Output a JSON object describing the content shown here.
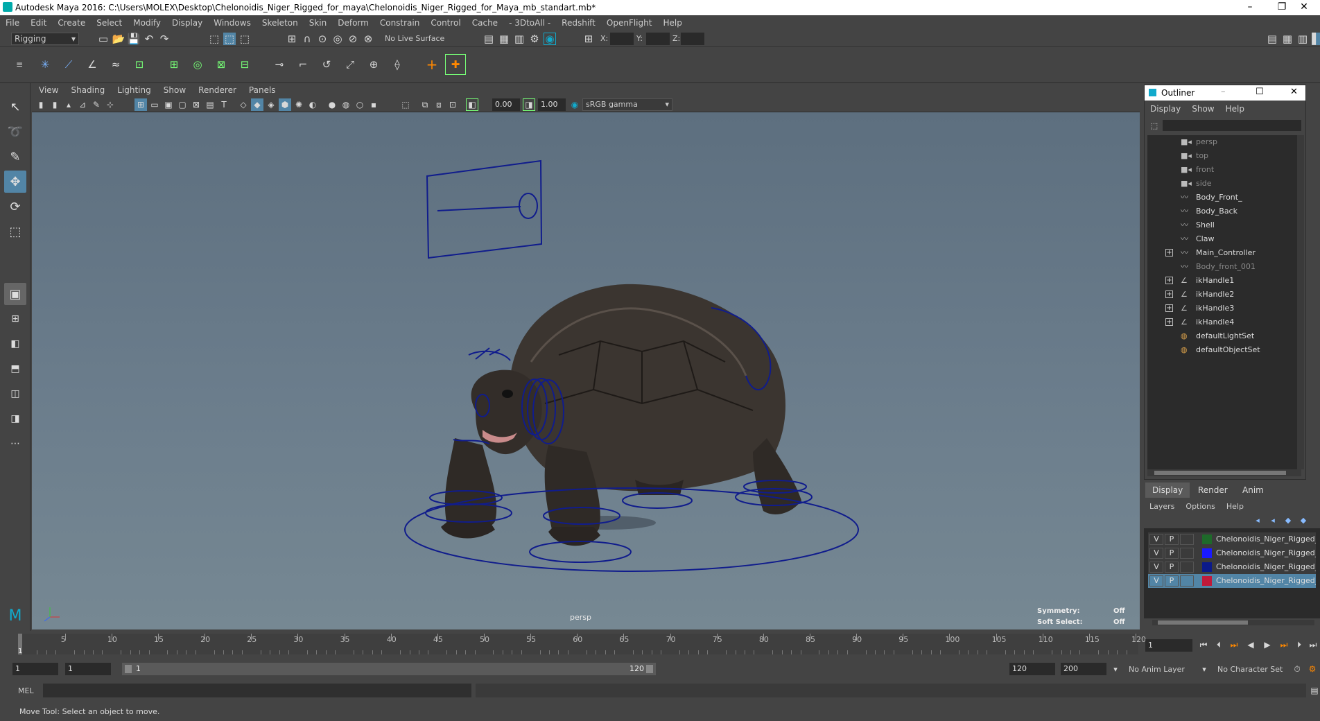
{
  "window": {
    "title": "Autodesk Maya 2016: C:\\Users\\MOLEX\\Desktop\\Chelonoidis_Niger_Rigged_for_maya\\Chelonoidis_Niger_Rigged_for_Maya_mb_standart.mb*"
  },
  "menu": [
    "File",
    "Edit",
    "Create",
    "Select",
    "Modify",
    "Display",
    "Windows",
    "Skeleton",
    "Skin",
    "Deform",
    "Constrain",
    "Control",
    "Cache",
    "- 3DtoAll -",
    "Redshift",
    "OpenFlight",
    "Help"
  ],
  "statusline": {
    "mode": "Rigging",
    "live_surface": "No Live Surface",
    "x_label": "X:",
    "y_label": "Y:",
    "z_label": "Z:"
  },
  "viewport": {
    "menu": [
      "View",
      "Shading",
      "Lighting",
      "Show",
      "Renderer",
      "Panels"
    ],
    "exposure": "0.00",
    "gamma": "1.00",
    "color_space": "sRGB gamma",
    "camera_label": "persp",
    "symmetry_label": "Symmetry:",
    "symmetry_value": "Off",
    "soft_select_label": "Soft Select:",
    "soft_select_value": "Off"
  },
  "outliner": {
    "title": "Outliner",
    "menu": [
      "Display",
      "Show",
      "Help"
    ],
    "items": [
      {
        "label": "persp",
        "icon": "camera-icon",
        "dim": true,
        "expand": false
      },
      {
        "label": "top",
        "icon": "camera-icon",
        "dim": true,
        "expand": false
      },
      {
        "label": "front",
        "icon": "camera-icon",
        "dim": true,
        "expand": false
      },
      {
        "label": "side",
        "icon": "camera-icon",
        "dim": true,
        "expand": false
      },
      {
        "label": "Body_Front_",
        "icon": "curve-icon",
        "dim": false,
        "expand": false
      },
      {
        "label": "Body_Back",
        "icon": "curve-icon",
        "dim": false,
        "expand": false
      },
      {
        "label": "Shell",
        "icon": "curve-icon",
        "dim": false,
        "expand": false
      },
      {
        "label": "Claw",
        "icon": "curve-icon",
        "dim": false,
        "expand": false
      },
      {
        "label": "Main_Controller",
        "icon": "curve-icon",
        "dim": false,
        "expand": true
      },
      {
        "label": "Body_front_001",
        "icon": "curve-icon",
        "dim": true,
        "expand": false
      },
      {
        "label": "ikHandle1",
        "icon": "ik-icon",
        "dim": false,
        "expand": true
      },
      {
        "label": "ikHandle2",
        "icon": "ik-icon",
        "dim": false,
        "expand": true
      },
      {
        "label": "ikHandle3",
        "icon": "ik-icon",
        "dim": false,
        "expand": true
      },
      {
        "label": "ikHandle4",
        "icon": "ik-icon",
        "dim": false,
        "expand": true
      },
      {
        "label": "defaultLightSet",
        "icon": "set-icon",
        "dim": false,
        "expand": false
      },
      {
        "label": "defaultObjectSet",
        "icon": "set-icon",
        "dim": false,
        "expand": false
      }
    ]
  },
  "layers": {
    "tabs": [
      "Display",
      "Render",
      "Anim"
    ],
    "menu": [
      "Layers",
      "Options",
      "Help"
    ],
    "items": [
      {
        "v": "V",
        "p": "P",
        "color": "#1e6a2a",
        "name": "Chelonoidis_Niger_Rigged_l",
        "selected": false
      },
      {
        "v": "V",
        "p": "P",
        "color": "#1a1aff",
        "name": "Chelonoidis_Niger_Rigged_l",
        "selected": false
      },
      {
        "v": "V",
        "p": "P",
        "color": "#0b1a8a",
        "name": "Chelonoidis_Niger_Rigged_l",
        "selected": false
      },
      {
        "v": "V",
        "p": "P",
        "color": "#c01a3a",
        "name": "Chelonoidis_Niger_Rigged_l",
        "selected": true
      }
    ]
  },
  "timeline": {
    "ticks": [
      "5",
      "10",
      "15",
      "20",
      "25",
      "30",
      "35",
      "40",
      "45",
      "50",
      "55",
      "60",
      "65",
      "70",
      "75",
      "80",
      "85",
      "90",
      "95",
      "100",
      "105",
      "110",
      "115",
      "120"
    ],
    "current_frame_marker": "1",
    "current_frame": "1"
  },
  "range": {
    "start": "1",
    "anim_start": "1",
    "slider_start": "1",
    "slider_end": "120",
    "end": "120",
    "anim_end": "200",
    "anim_layer": "No Anim Layer",
    "character_set": "No Character Set"
  },
  "command": {
    "label": "MEL"
  },
  "help": {
    "text": "Move Tool: Select an object to move."
  }
}
